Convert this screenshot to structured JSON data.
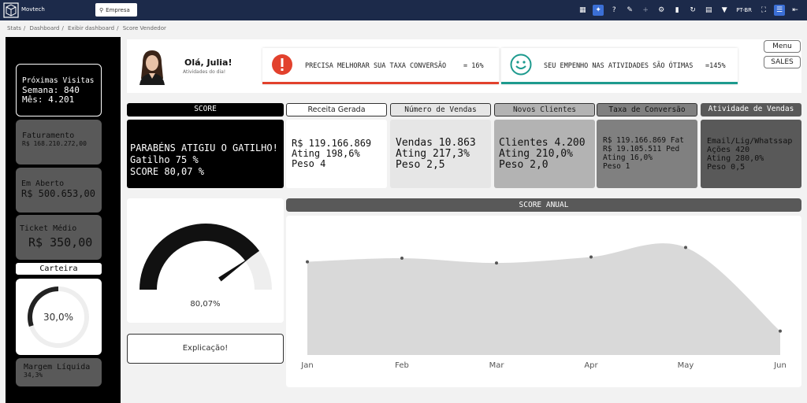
{
  "topbar": {
    "app_name": "Movtech",
    "filter_label": "Empresa",
    "language": "PT-BR",
    "icons": [
      "grid-icon",
      "pin-icon",
      "help-icon",
      "edit-icon",
      "plus-icon",
      "gear-icon",
      "bookmark-icon",
      "refresh-icon",
      "calendar-icon",
      "filter-icon",
      "fullscreen-icon",
      "menu-icon",
      "arrow-left-icon"
    ]
  },
  "breadcrumb": [
    "Stats",
    "Dashboard",
    "Exibir dashboard",
    "Score Vendedor"
  ],
  "left": {
    "visits_title": "Próximas Visitas",
    "visits_week": "Semana: 840",
    "visits_month": "Mês: 4.201",
    "fat_title": "Faturamento",
    "fat_value": "R$ 168.210.272,00",
    "open_title": "Em Aberto",
    "open_value": "R$ 500.653,00",
    "ticket_title": "Ticket Médio",
    "ticket_value": "R$ 350,00",
    "cart_label": "Carteira",
    "cart_value": "30,0%",
    "cart_fraction": 0.3,
    "margin_title": "Margem Líquida",
    "margin_value": "34,3%"
  },
  "header": {
    "greeting": "Olá, Julia!",
    "subtitle": "Atividades do dia!",
    "alert1_text": "PRECISA MELHORAR SUA TAXA CONVERSÃO",
    "alert1_value": "= 16%",
    "alert2_text": "SEU EMPENHO NAS ATIVIDADES SÃO ÓTIMAS",
    "alert2_value": "=145%",
    "menu_label": "Menu",
    "sales_label": "SALES"
  },
  "tabs": {
    "score": "SCORE",
    "receita": "Receita Gerada",
    "vendas": "Número de Vendas",
    "clientes": "Novos Clientes",
    "conversao": "Taxa de Conversão",
    "atividade": "Atividade de Vendas"
  },
  "cards": {
    "score_l1": "PARABÉNS ATIGIU O GATILHO!",
    "score_l2": "Gatilho 75 %",
    "score_l3": "SCORE 80,07 %",
    "rec_l1": "R$ 119.166.869",
    "rec_l2": "Ating 198,6%",
    "rec_l3": "Peso 4",
    "vend_l1": "Vendas 10.863",
    "vend_l2": "Ating 217,3%",
    "vend_l3": "Peso 2,5",
    "cli_l1": "Clientes 4.200",
    "cli_l2": "Ating 210,0%",
    "cli_l3": "Peso 2,0",
    "conv_l1": "R$ 119.166.869 Fat",
    "conv_l2": "R$ 19.105.511 Ped",
    "conv_l3": "Ating 16,0%",
    "conv_l4": "Peso 1",
    "ativ_l1": "Email/Lig/Whatssap",
    "ativ_l2": "Ações 420",
    "ativ_l3": "Ating 280,0%",
    "ativ_l4": "Peso 0,5"
  },
  "gauge": {
    "value_label": "80,07%",
    "value": 80.07,
    "max": 100
  },
  "explain_button": "Explicação!",
  "annual_title": "SCORE ANUAL",
  "chart_data": {
    "type": "area",
    "categories": [
      "Jan",
      "Feb",
      "Mar",
      "Apr",
      "May",
      "Jun"
    ],
    "series": [
      {
        "values": [
          78,
          81,
          77,
          82,
          90,
          20
        ]
      }
    ],
    "ylim": [
      0,
      110
    ],
    "grid": false,
    "colors": {
      "fill": "#d9d9d9",
      "point": "#555555"
    }
  }
}
